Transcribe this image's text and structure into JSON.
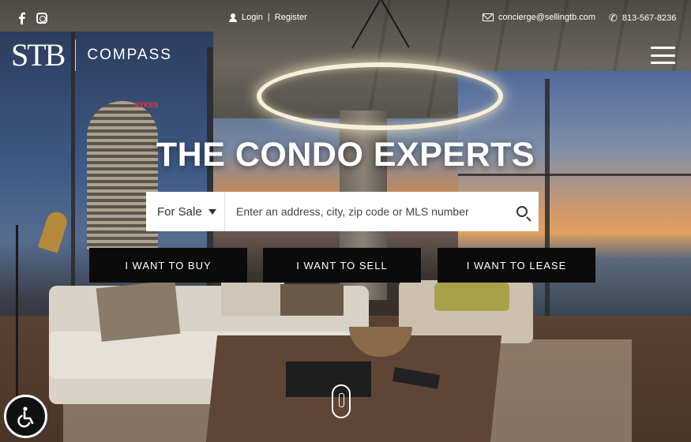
{
  "topbar": {
    "social": [
      {
        "icon": "facebook-icon"
      },
      {
        "icon": "instagram-icon"
      }
    ],
    "login_label": "Login",
    "separator": "|",
    "register_label": "Register",
    "email": "concierge@sellingtb.com",
    "phone": "813-567-8236"
  },
  "logo": {
    "mark": "STB",
    "brand": "COMPASS"
  },
  "hero": {
    "headline": "THE CONDO EXPERTS",
    "tower_sign": "SYKES"
  },
  "search": {
    "select_value": "For Sale",
    "placeholder": "Enter an address, city, zip code or MLS number"
  },
  "ctas": {
    "buy": "I WANT TO BUY",
    "sell": "I WANT TO SELL",
    "lease": "I WANT TO LEASE"
  },
  "colors": {
    "cta_bg": "#0b0b0b",
    "text_light": "#ffffff"
  }
}
